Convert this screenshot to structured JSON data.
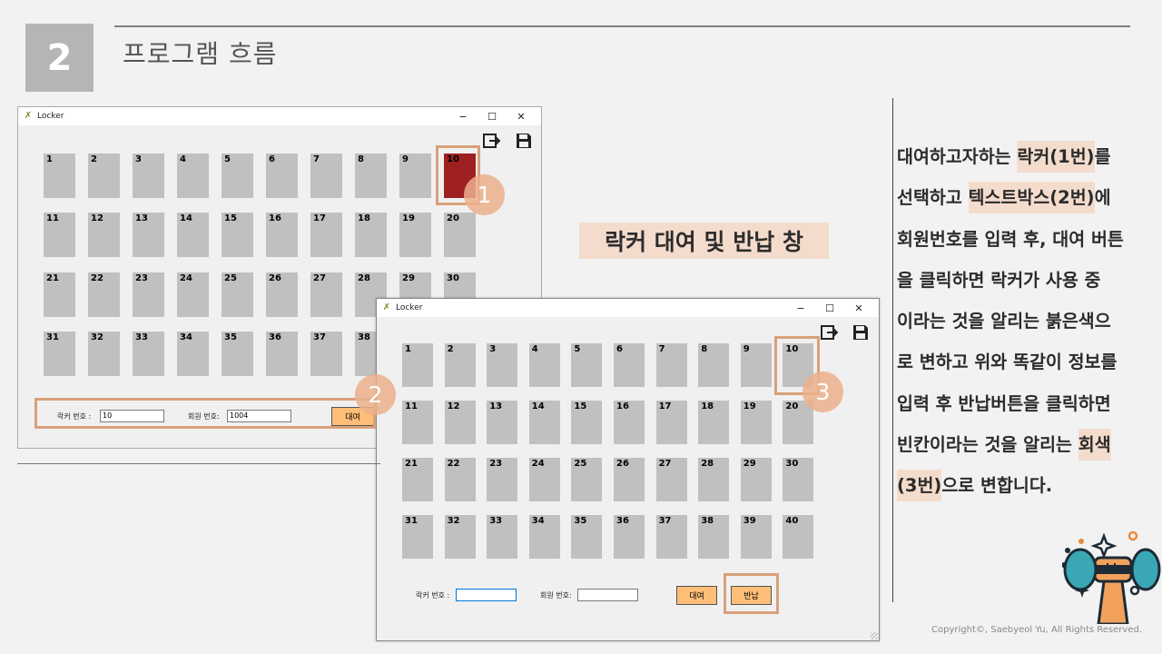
{
  "slide": {
    "number": "2",
    "title": "프로그램 흐름",
    "caption": "락커 대여 및 반납 창",
    "copyright": "Copyright©, Saebyeol Yu, All Rights Reserved.",
    "badges": [
      "1",
      "2",
      "3"
    ]
  },
  "description": {
    "lines": [
      [
        {
          "t": "대여하고자하는 "
        },
        {
          "t": "락커(1번)",
          "mark": true
        },
        {
          "t": "를"
        }
      ],
      [
        {
          "t": "선택하고 "
        },
        {
          "t": "텍스트박스(2번)",
          "mark": true
        },
        {
          "t": "에"
        }
      ],
      [
        {
          "t": "회원번호를 입력 후, 대여 버튼"
        }
      ],
      [
        {
          "t": "을 클릭하면 락커가 사용 중"
        }
      ],
      [
        {
          "t": "이라는 것을 알리는 붉은색으"
        }
      ],
      [
        {
          "t": "로 변하고 위와 똑같이 정보를"
        }
      ],
      [
        {
          "t": "입력 후 반납버튼을 클릭하면"
        }
      ],
      [
        {
          "t": "빈칸이라는 것을 알리는 "
        },
        {
          "t": "회색",
          "mark": true
        }
      ],
      [
        {
          "t": "(3번)",
          "mark": true
        },
        {
          "t": "으로 변합니다."
        }
      ]
    ]
  },
  "window1": {
    "title": "Locker",
    "controls": [
      "−",
      "☐",
      "✕"
    ],
    "icons": [
      "exit-icon",
      "save-icon"
    ],
    "lockers": [
      "1",
      "2",
      "3",
      "4",
      "5",
      "6",
      "7",
      "8",
      "9",
      "10",
      "11",
      "12",
      "13",
      "14",
      "15",
      "16",
      "17",
      "18",
      "19",
      "20",
      "21",
      "22",
      "23",
      "24",
      "25",
      "26",
      "27",
      "28",
      "29",
      "30",
      "31",
      "32",
      "33",
      "34",
      "35",
      "36",
      "37",
      "38"
    ],
    "used_locker": "10",
    "locker_label": "락커 번호 :",
    "locker_value": "10",
    "member_label": "회원 번호:",
    "member_value": "1004",
    "rent_button": "대여",
    "used_color": "#9e2020"
  },
  "window2": {
    "title": "Locker",
    "controls": [
      "−",
      "☐",
      "✕"
    ],
    "icons": [
      "exit-icon",
      "save-icon"
    ],
    "lockers": [
      "1",
      "2",
      "3",
      "4",
      "5",
      "6",
      "7",
      "8",
      "9",
      "10",
      "11",
      "12",
      "13",
      "14",
      "15",
      "16",
      "17",
      "18",
      "19",
      "20",
      "21",
      "22",
      "23",
      "24",
      "25",
      "26",
      "27",
      "28",
      "29",
      "30",
      "31",
      "32",
      "33",
      "34",
      "35",
      "36",
      "37",
      "38",
      "39",
      "40"
    ],
    "locker_label": "락커 번호 :",
    "locker_value": "",
    "member_label": "회원 번호:",
    "member_value": "",
    "rent_button": "대여",
    "return_button": "반납"
  },
  "colors": {
    "accent": "#d9a07a",
    "highlight": "#f4dccd",
    "button": "#ffbe78",
    "locker_empty": "#c0c0c0"
  }
}
